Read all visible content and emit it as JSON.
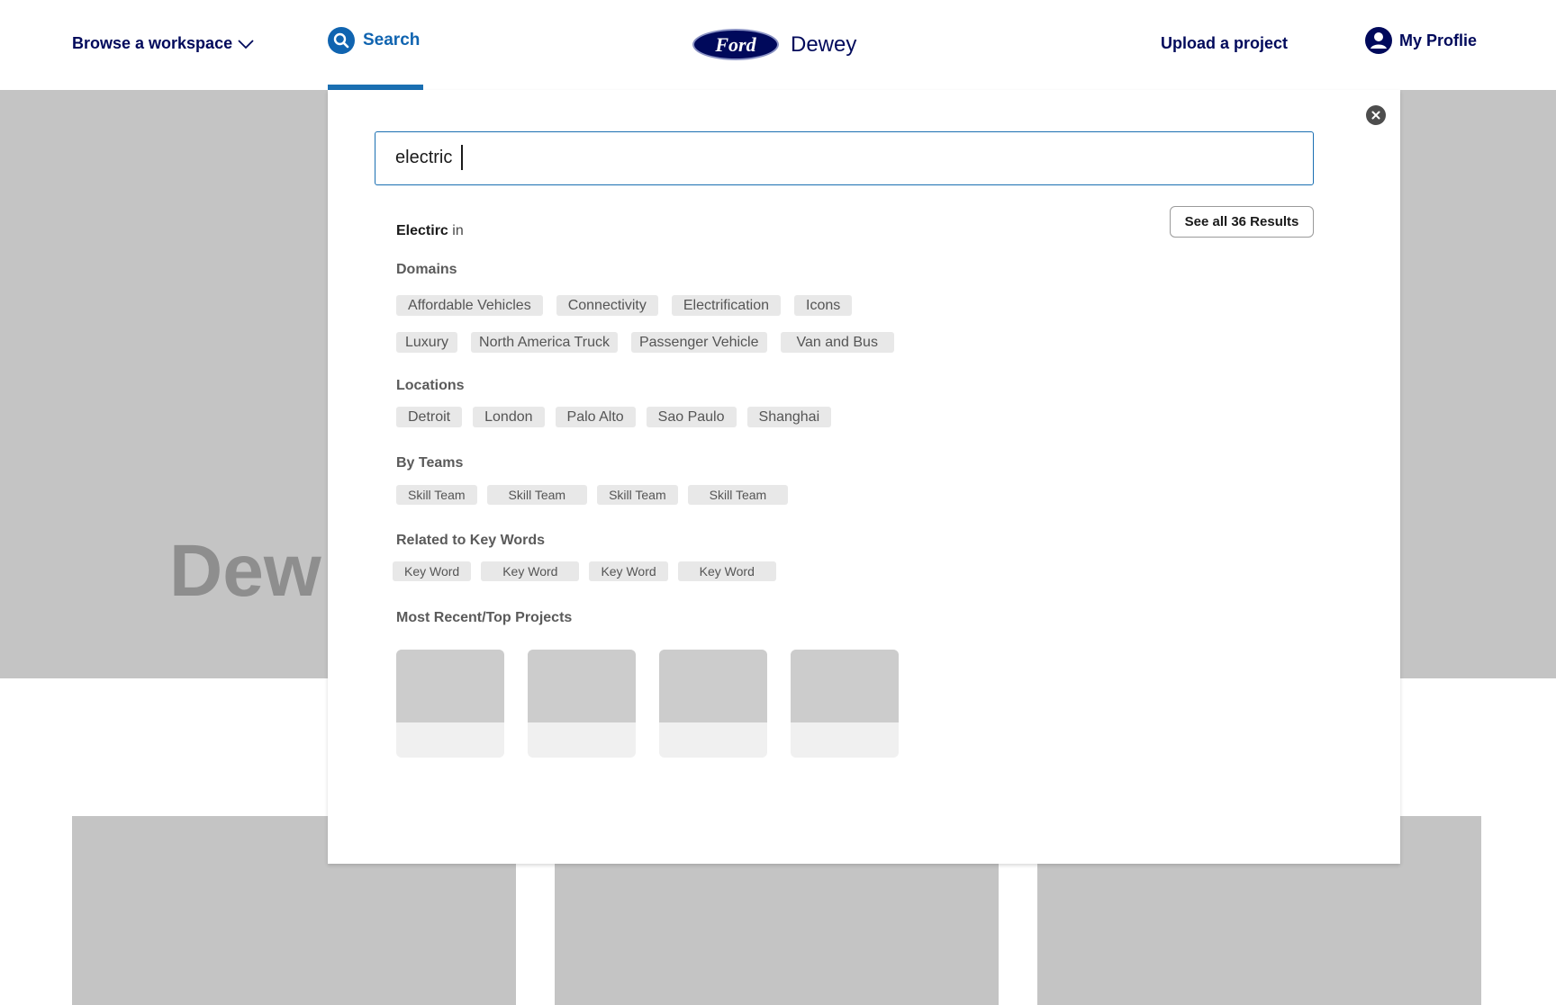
{
  "header": {
    "browse_label": "Browse a workspace",
    "search_label": "Search",
    "brand_logo": "Ford",
    "brand_name": "Dewey",
    "upload_label": "Upload a project",
    "profile_label": "My Proflie"
  },
  "hero": {
    "title_fragment": "Dew"
  },
  "search": {
    "query": "electric",
    "see_all_label": "See all 36 Results",
    "results_term": "Electirc",
    "results_suffix": "in",
    "close_icon": "close-icon"
  },
  "sections": {
    "domains": {
      "label": "Domains",
      "row1": [
        "Affordable Vehicles",
        "Connectivity",
        "Electrification",
        "Icons"
      ],
      "row2": [
        "Luxury",
        "North America Truck",
        "Passenger Vehicle",
        "Van and Bus"
      ]
    },
    "locations": {
      "label": "Locations",
      "items": [
        "Detroit",
        "London",
        "Palo Alto",
        "Sao Paulo",
        "Shanghai"
      ]
    },
    "teams": {
      "label": "By Teams",
      "items": [
        "Skill Team",
        "Skill Team",
        "Skill Team",
        "Skill Team"
      ]
    },
    "keywords": {
      "label": "Related to Key Words",
      "items": [
        "Key Word",
        "Key Word",
        "Key Word",
        "Key Word"
      ]
    },
    "projects": {
      "label": "Most Recent/Top Projects",
      "count": 4
    }
  },
  "colors": {
    "brand_navy": "#00095b",
    "accent_blue": "#1064b0",
    "chip_bg": "#e8e8e8",
    "placeholder_gray": "#c4c4c4"
  }
}
